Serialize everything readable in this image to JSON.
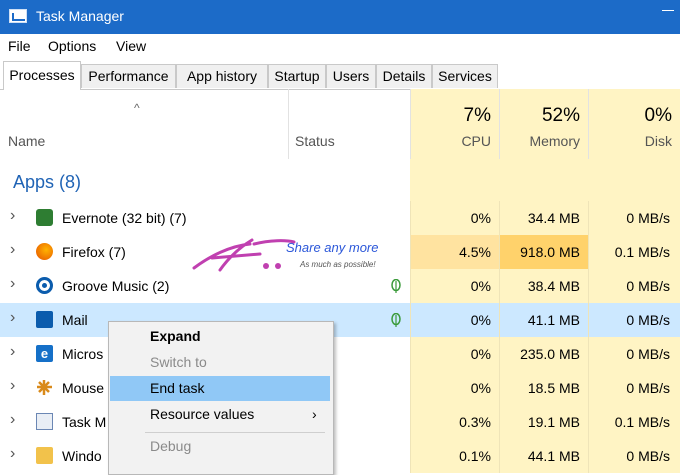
{
  "window": {
    "title": "Task Manager"
  },
  "menu": [
    "File",
    "Options",
    "View"
  ],
  "tabs": [
    "Processes",
    "Performance",
    "App history",
    "Startup",
    "Users",
    "Details",
    "Services"
  ],
  "columns": {
    "name": "Name",
    "status": "Status",
    "cpu": {
      "pct": "7%",
      "label": "CPU"
    },
    "memory": {
      "pct": "52%",
      "label": "Memory"
    },
    "disk": {
      "pct": "0%",
      "label": "Disk"
    }
  },
  "group": {
    "label": "Apps (8)"
  },
  "rows": [
    {
      "name": "Evernote (32 bit) (7)",
      "cpu": "0%",
      "mem": "34.4 MB",
      "disk": "0 MB/s",
      "icon": "evernote-icon",
      "leaf": false
    },
    {
      "name": "Firefox (7)",
      "cpu": "4.5%",
      "mem": "918.0 MB",
      "disk": "0.1 MB/s",
      "icon": "firefox-icon",
      "leaf": false
    },
    {
      "name": "Groove Music (2)",
      "cpu": "0%",
      "mem": "38.4 MB",
      "disk": "0 MB/s",
      "icon": "groove-icon",
      "leaf": true
    },
    {
      "name": "Mail",
      "cpu": "0%",
      "mem": "41.1 MB",
      "disk": "0 MB/s",
      "icon": "mail-icon",
      "leaf": true
    },
    {
      "name": "Micros",
      "cpu": "0%",
      "mem": "235.0 MB",
      "disk": "0 MB/s",
      "icon": "edge-icon",
      "leaf": false
    },
    {
      "name": "Mouse",
      "cpu": "0%",
      "mem": "18.5 MB",
      "disk": "0 MB/s",
      "icon": "mouse-icon",
      "leaf": false
    },
    {
      "name": "Task M",
      "cpu": "0.3%",
      "mem": "19.1 MB",
      "disk": "0.1 MB/s",
      "icon": "taskmgr-icon",
      "leaf": false
    },
    {
      "name": "Windo",
      "cpu": "0.1%",
      "mem": "44.1 MB",
      "disk": "0 MB/s",
      "icon": "explorer-icon",
      "leaf": false
    }
  ],
  "context_menu": {
    "expand": "Expand",
    "switch_to": "Switch to",
    "end_task": "End task",
    "resource_values": "Resource values",
    "debug": "Debug"
  },
  "watermark": {
    "main": "Share any more",
    "sub": "As much as possible!"
  },
  "colors": {
    "accent": "#1c6bc8",
    "heat_low": "#fff4c4",
    "heat_high": "#ffd26b",
    "selected": "#cce8ff",
    "hover_menu": "#90c8f6"
  }
}
